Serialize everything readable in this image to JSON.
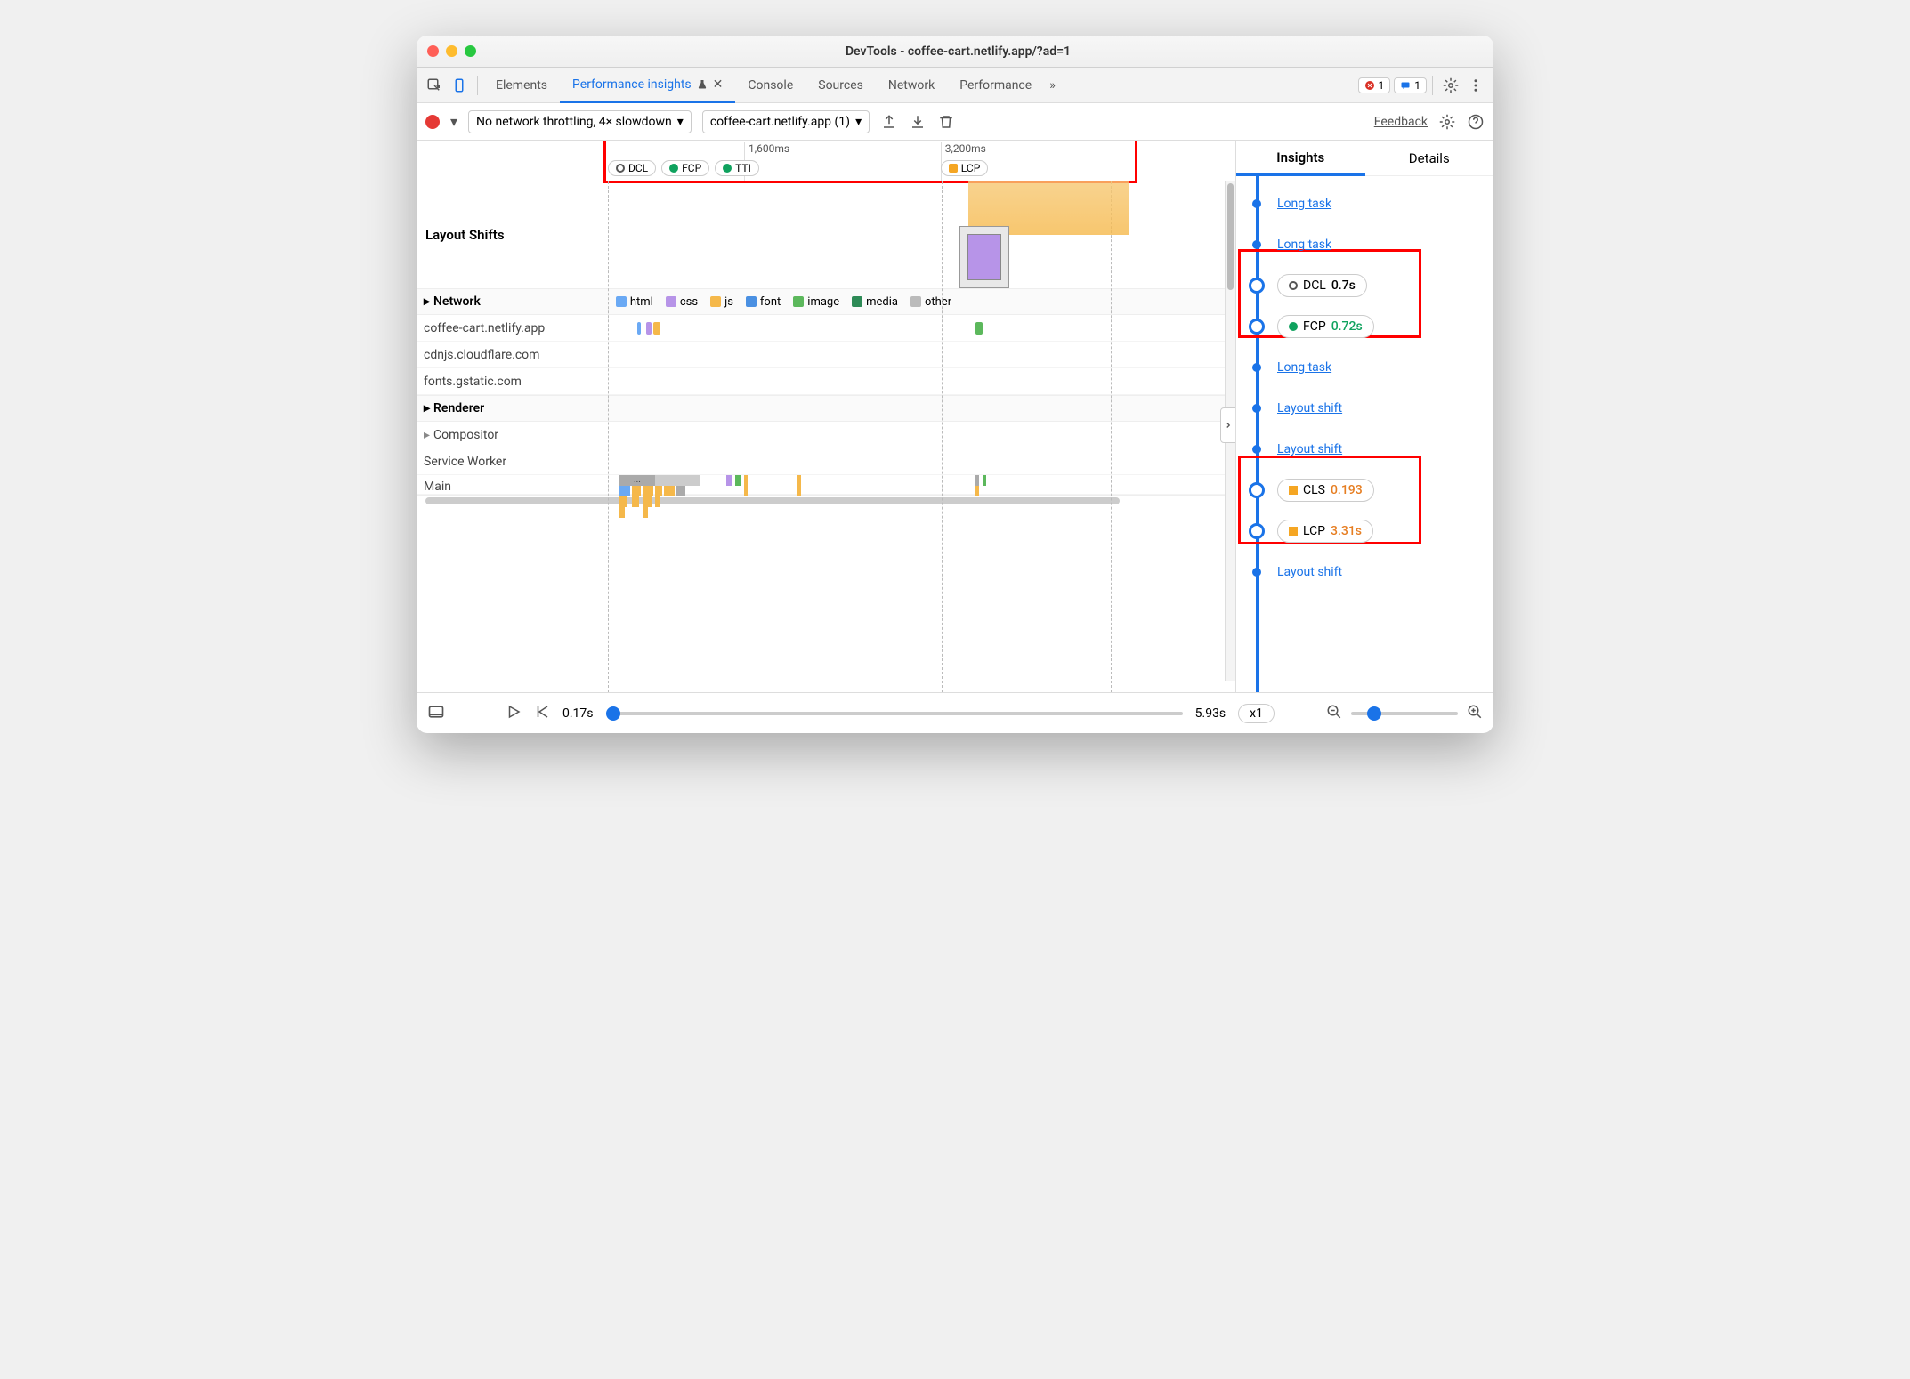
{
  "window": {
    "title": "DevTools - coffee-cart.netlify.app/?ad=1"
  },
  "tabs": {
    "items": [
      "Elements",
      "Performance insights",
      "Console",
      "Sources",
      "Network",
      "Performance"
    ],
    "active": "Performance insights",
    "more": "»",
    "errors": "1",
    "messages": "1"
  },
  "toolbar": {
    "throttling": "No network throttling, 4× slowdown",
    "profile": "coffee-cart.netlify.app (1)",
    "feedback": "Feedback"
  },
  "ruler": {
    "ticks": [
      {
        "label": "1,600ms",
        "leftPct": 40
      },
      {
        "label": "3,200ms",
        "leftPct": 64
      }
    ],
    "pills_left": [
      {
        "label": "DCL",
        "color": "#fff",
        "border": "#555"
      },
      {
        "label": "FCP",
        "color": "#0fa25e"
      },
      {
        "label": "TTI",
        "color": "#0fa25e"
      }
    ],
    "pill_right": {
      "label": "LCP",
      "color": "#f5a623"
    }
  },
  "tracks": {
    "layout_shifts": "Layout Shifts",
    "network": "Network",
    "legend": [
      {
        "label": "html",
        "color": "#6aa9f4"
      },
      {
        "label": "css",
        "color": "#b794e8"
      },
      {
        "label": "js",
        "color": "#f5b84a"
      },
      {
        "label": "font",
        "color": "#4a90e2"
      },
      {
        "label": "image",
        "color": "#5cb85c"
      },
      {
        "label": "media",
        "color": "#2e8b57"
      },
      {
        "label": "other",
        "color": "#bbb"
      }
    ],
    "network_rows": [
      "coffee-cart.netlify.app",
      "cdnjs.cloudflare.com",
      "fonts.gstatic.com"
    ],
    "renderer": "Renderer",
    "renderer_rows": [
      "Compositor",
      "Service Worker",
      "Main"
    ]
  },
  "insights": {
    "tabs": [
      "Insights",
      "Details"
    ],
    "active": "Insights",
    "events": [
      {
        "type": "link",
        "text": "Long task"
      },
      {
        "type": "link",
        "text": "Long task"
      },
      {
        "type": "metric",
        "name": "DCL",
        "value": "0.7s",
        "marker": "o",
        "color": "#555",
        "valcolor": "#333"
      },
      {
        "type": "metric",
        "name": "FCP",
        "value": "0.72s",
        "marker": "dot",
        "color": "#0fa25e",
        "valcolor": "#0fa25e"
      },
      {
        "type": "link",
        "text": "Long task"
      },
      {
        "type": "link",
        "text": "Layout shift"
      },
      {
        "type": "link",
        "text": "Layout shift"
      },
      {
        "type": "metric",
        "name": "CLS",
        "value": "0.193",
        "marker": "sq",
        "color": "#f5a623",
        "valcolor": "#e67e22"
      },
      {
        "type": "metric",
        "name": "LCP",
        "value": "3.31s",
        "marker": "sq",
        "color": "#f5a623",
        "valcolor": "#e67e22"
      },
      {
        "type": "link",
        "text": "Layout shift"
      }
    ]
  },
  "footer": {
    "start": "0.17s",
    "end": "5.93s",
    "speed": "x1"
  }
}
